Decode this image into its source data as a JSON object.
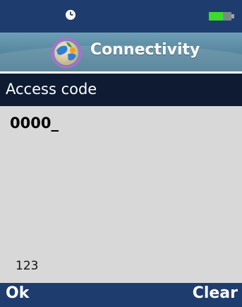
{
  "status_bar": {
    "clock_icon": "clock-icon",
    "battery_icon": "battery-icon"
  },
  "title_bar": {
    "icon": "globe-icon",
    "title": "Connectivity"
  },
  "form": {
    "label": "Access code",
    "value": "0000_",
    "input_mode": "123"
  },
  "softkeys": {
    "left": "Ok",
    "right": "Clear"
  },
  "colors": {
    "bar_blue": "#1f3c6e",
    "header_dark": "#0e1b33",
    "content_gray": "#d8d8d8",
    "title_teal": "#5a8aa1",
    "battery_green": "#3ddc2a"
  }
}
